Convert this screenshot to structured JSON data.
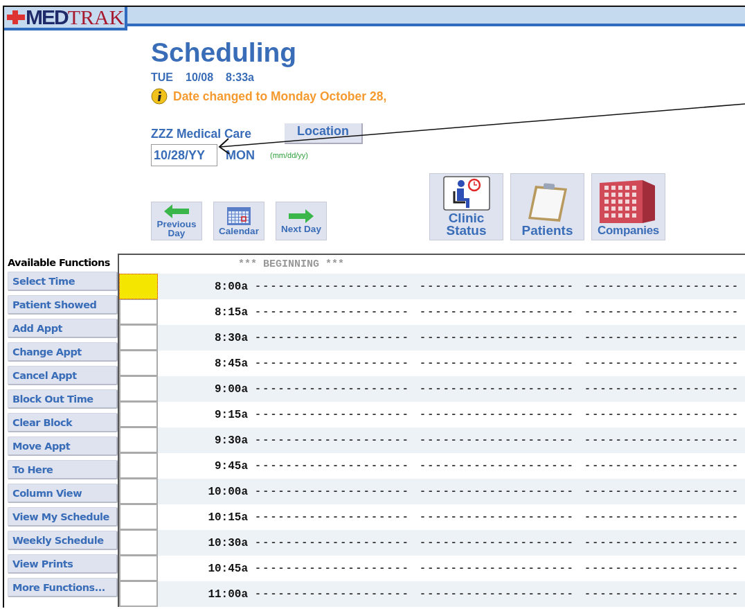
{
  "logo": {
    "prefix": "MED",
    "suffix": "TRAK"
  },
  "title": "Scheduling",
  "current": {
    "day": "TUE",
    "date": "10/08",
    "time": "8:33a"
  },
  "notice": "Date changed to Monday October 28,",
  "location": {
    "name": "ZZZ Medical Care",
    "button": "Location"
  },
  "date_field": {
    "value": "10/28/YY",
    "weekday": "MON",
    "format_hint": "(mm/dd/yy)"
  },
  "nav_buttons": [
    {
      "kind": "prev",
      "label": "Previous Day"
    },
    {
      "kind": "calendar",
      "label": "Calendar"
    },
    {
      "kind": "next",
      "label": "Next Day"
    }
  ],
  "big_buttons": [
    {
      "kind": "clinic",
      "label": "Clinic Status"
    },
    {
      "kind": "patients",
      "label": "Patients"
    },
    {
      "kind": "companies",
      "label": "Companies"
    }
  ],
  "sidebar": {
    "heading": "Available Functions",
    "items": [
      "Select Time",
      "Patient Showed",
      "Add Appt",
      "Change Appt",
      "Cancel Appt",
      "Block Out Time",
      "Clear Block",
      "Move Appt",
      "To Here",
      "Column View",
      "View My Schedule",
      "Weekly Schedule",
      "View Prints",
      "More Functions..."
    ]
  },
  "schedule": {
    "header": "*** BEGINNING ***",
    "rows": [
      {
        "time": "8:00a",
        "selected": true,
        "slots": [
          "--------------------",
          "--------------------",
          "--------------------"
        ]
      },
      {
        "time": "8:15a",
        "selected": false,
        "slots": [
          "--------------------",
          "--------------------",
          "--------------------"
        ]
      },
      {
        "time": "8:30a",
        "selected": false,
        "slots": [
          "--------------------",
          "--------------------",
          "--------------------"
        ]
      },
      {
        "time": "8:45a",
        "selected": false,
        "slots": [
          "--------------------",
          "--------------------",
          "--------------------"
        ]
      },
      {
        "time": "9:00a",
        "selected": false,
        "slots": [
          "--------------------",
          "--------------------",
          "--------------------"
        ]
      },
      {
        "time": "9:15a",
        "selected": false,
        "slots": [
          "--------------------",
          "--------------------",
          "--------------------"
        ]
      },
      {
        "time": "9:30a",
        "selected": false,
        "slots": [
          "--------------------",
          "--------------------",
          "--------------------"
        ]
      },
      {
        "time": "9:45a",
        "selected": false,
        "slots": [
          "--------------------",
          "--------------------",
          "--------------------"
        ]
      },
      {
        "time": "10:00a",
        "selected": false,
        "slots": [
          "--------------------",
          "--------------------",
          "--------------------"
        ]
      },
      {
        "time": "10:15a",
        "selected": false,
        "slots": [
          "--------------------",
          "--------------------",
          "--------------------"
        ]
      },
      {
        "time": "10:30a",
        "selected": false,
        "slots": [
          "--------------------",
          "--------------------",
          "--------------------"
        ]
      },
      {
        "time": "10:45a",
        "selected": false,
        "slots": [
          "--------------------",
          "--------------------",
          "--------------------"
        ]
      },
      {
        "time": "11:00a",
        "selected": false,
        "slots": [
          "--------------------",
          "--------------------",
          "--------------------"
        ]
      }
    ]
  }
}
